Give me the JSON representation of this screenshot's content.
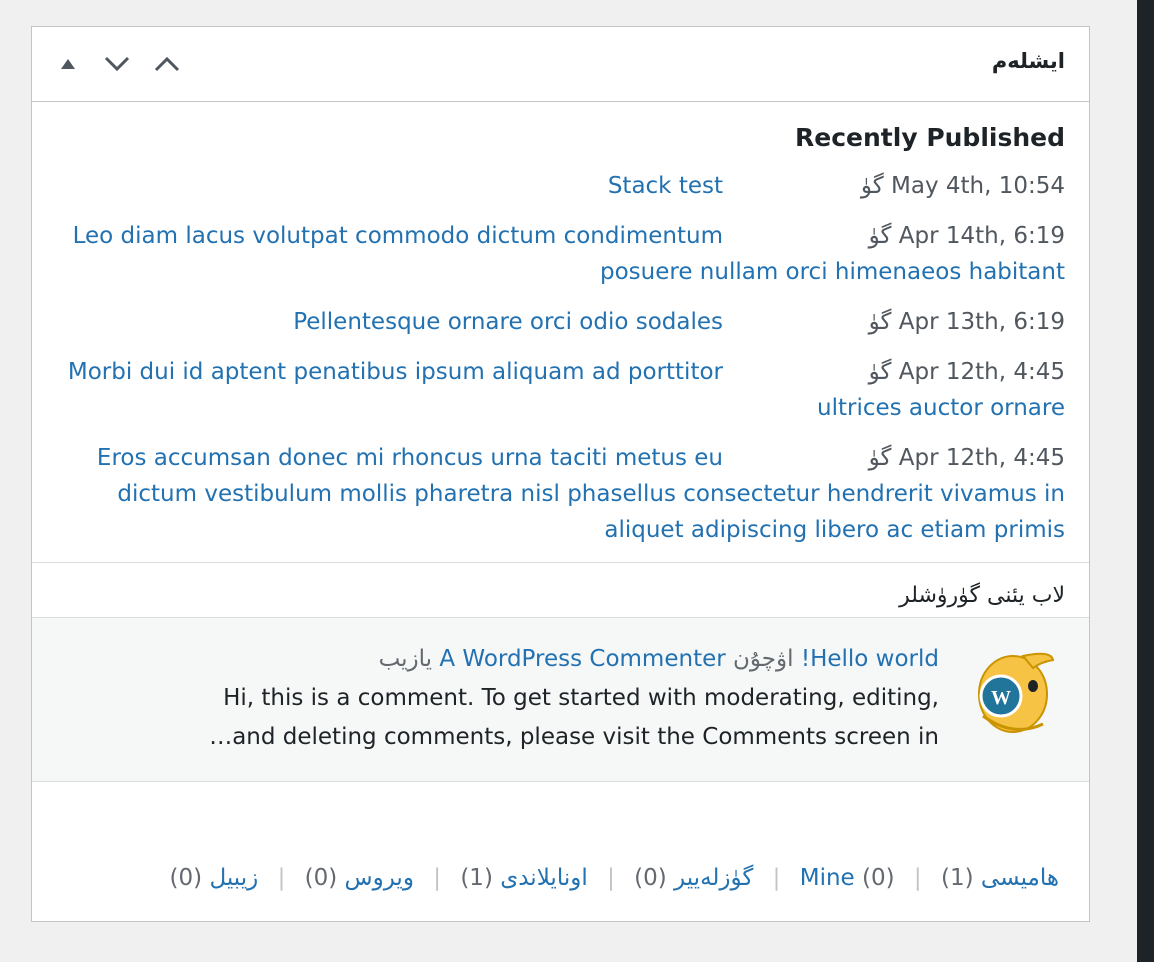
{
  "panel": {
    "title": "ايشلەم",
    "controls": [
      "move-up-icon",
      "move-down-icon",
      "toggle-panel-icon"
    ]
  },
  "recent": {
    "title": "Recently Published",
    "items": [
      {
        "date": "May 4th, 10:54 گۈ",
        "title": "Stack test"
      },
      {
        "date": "Apr 14th, 6:19 گۈ",
        "title": "Leo diam lacus volutpat commodo dictum condimentum posuere nullam orci himenaeos habitant"
      },
      {
        "date": "Apr 13th, 6:19 گۈ",
        "title": "Pellentesque ornare orci odio sodales"
      },
      {
        "date": "Apr 12th, 4:45 گۈ",
        "title": "Morbi dui id aptent penatibus ipsum aliquam ad porttitor ultrices auctor ornare"
      },
      {
        "date": "Apr 12th, 4:45 گۈ",
        "title": "Eros accumsan donec mi rhoncus urna taciti metus eu dictum vestibulum mollis pharetra nisl phasellus consectetur hendrerit vivamus in aliquet adipiscing libero ac etiam primis"
      }
    ]
  },
  "comments": {
    "title": "لاب يئنى گۈرۈشلر",
    "item": {
      "author_prefix": "يازيب",
      "author": "A WordPress Commenter",
      "on": "اۋچۇن",
      "post": "Hello world!",
      "text": "Hi, this is a comment. To get started with moderating, editing, and deleting comments, please visit the Comments screen in…"
    }
  },
  "filters": [
    {
      "label": "هاميسى",
      "count": "(1)"
    },
    {
      "label": "Mine",
      "count": "(0)"
    },
    {
      "label": "گۈزلەيير",
      "count": "(0)"
    },
    {
      "label": "اونايلاندى",
      "count": "(1)"
    },
    {
      "label": "ويروس",
      "count": "(0)"
    },
    {
      "label": "زيبيل",
      "count": "(0)"
    }
  ],
  "colors": {
    "link": "#2271b1",
    "text": "#1d2327",
    "muted": "#50575e",
    "border": "#c3c4c7"
  }
}
